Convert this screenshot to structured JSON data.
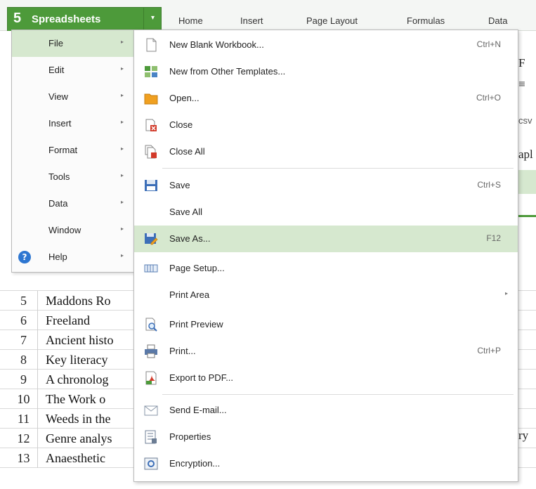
{
  "app": {
    "logo": "5",
    "name": "Spreadsheets",
    "drop_arrow": "▾"
  },
  "ribbon_tabs": [
    "Home",
    "Insert",
    "Page Layout",
    "Formulas",
    "Data"
  ],
  "app_menu": {
    "items": [
      {
        "label": "File",
        "arrow": "▸"
      },
      {
        "label": "Edit",
        "arrow": "▸"
      },
      {
        "label": "View",
        "arrow": "▸"
      },
      {
        "label": "Insert",
        "arrow": "▸"
      },
      {
        "label": "Format",
        "arrow": "▸"
      },
      {
        "label": "Tools",
        "arrow": "▸"
      },
      {
        "label": "Data",
        "arrow": "▸"
      },
      {
        "label": "Window",
        "arrow": "▸"
      },
      {
        "label": "Help",
        "arrow": "▸",
        "icon": "?"
      }
    ]
  },
  "file_menu": {
    "items": [
      {
        "label": "New Blank Workbook...",
        "shortcut": "Ctrl+N",
        "icon": "new-document-icon"
      },
      {
        "label": "New from Other Templates...",
        "shortcut": "",
        "icon": "template-icon"
      },
      {
        "label": "Open...",
        "shortcut": "Ctrl+O",
        "icon": "open-folder-icon"
      },
      {
        "label": "Close",
        "shortcut": "",
        "icon": "close-document-icon"
      },
      {
        "label": "Close All",
        "shortcut": "",
        "icon": "close-all-icon"
      },
      {
        "label": "Save",
        "shortcut": "Ctrl+S",
        "icon": "save-icon"
      },
      {
        "label": "Save All",
        "shortcut": "",
        "icon": ""
      },
      {
        "label": "Save As...",
        "shortcut": "F12",
        "icon": "save-as-icon"
      },
      {
        "label": "Page Setup...",
        "shortcut": "",
        "icon": "page-setup-icon"
      },
      {
        "label": "Print Area",
        "shortcut": "",
        "icon": "",
        "arrow": "▸"
      },
      {
        "label": "Print Preview",
        "shortcut": "",
        "icon": "print-preview-icon"
      },
      {
        "label": "Print...",
        "shortcut": "Ctrl+P",
        "icon": "printer-icon"
      },
      {
        "label": "Export to PDF...",
        "shortcut": "",
        "icon": "pdf-icon"
      },
      {
        "label": "Send E-mail...",
        "shortcut": "",
        "icon": "mail-icon"
      },
      {
        "label": "Properties",
        "shortcut": "",
        "icon": "properties-icon"
      },
      {
        "label": "Encryption...",
        "shortcut": "",
        "icon": "encryption-icon"
      }
    ]
  },
  "sheet_rows": [
    {
      "num": "5",
      "text": "Maddons Ro"
    },
    {
      "num": "6",
      "text": "Freeland"
    },
    {
      "num": "7",
      "text": "Ancient histo"
    },
    {
      "num": "8",
      "text": "Key literacy"
    },
    {
      "num": "9",
      "text": "A chronolog"
    },
    {
      "num": "10",
      "text": "The Work o"
    },
    {
      "num": "11",
      "text": "Weeds in the"
    },
    {
      "num": "12",
      "text": "Genre analys"
    },
    {
      "num": "13",
      "text": "Anaesthetic"
    }
  ],
  "right_fragments": {
    "r1": "F",
    "r2": "≡",
    "r3": "csv",
    "r4": "apl",
    "r5": "ry"
  },
  "colors": {
    "brand_green": "#4d9a3a",
    "highlight": "#d6e8cf",
    "help_blue": "#2d76d1"
  }
}
